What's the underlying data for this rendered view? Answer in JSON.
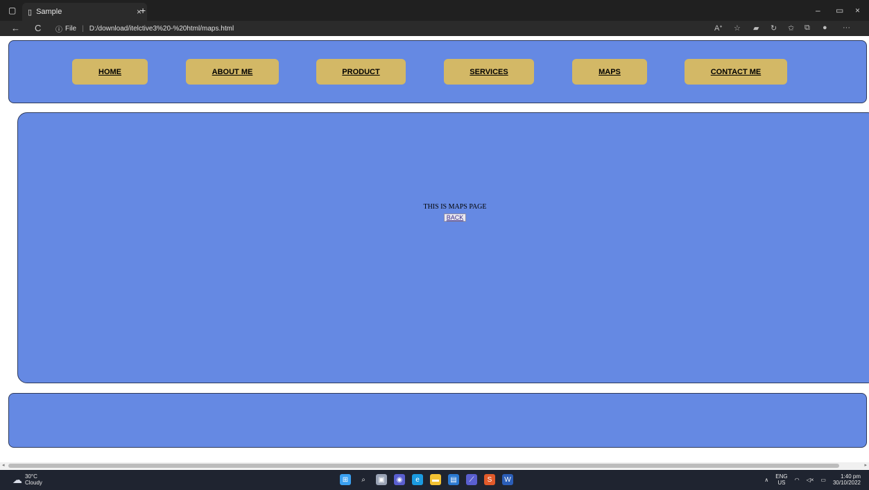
{
  "browser": {
    "tab_title": "Sample",
    "tab_close": "×",
    "new_tab": "+",
    "url_prefix": "File",
    "url": "D:/download/itelctive3%20-%20html/maps.html",
    "back_glyph": "←",
    "reload_glyph": "C",
    "window_min": "–",
    "window_max": "▭",
    "window_close": "×",
    "more_glyph": "···"
  },
  "nav": {
    "items": [
      {
        "label": "HOME"
      },
      {
        "label": "ABOUT ME"
      },
      {
        "label": "PRODUCT"
      },
      {
        "label": "SERVICES"
      },
      {
        "label": "MAPS"
      },
      {
        "label": "CONTACT ME"
      }
    ]
  },
  "main": {
    "text": "THIS IS MAPS PAGE",
    "back_label": "BACK"
  },
  "taskbar": {
    "weather_temp": "30°C",
    "weather_desc": "Cloudy",
    "lang": "ENG",
    "region": "US",
    "time": "1:40 pm",
    "date": "30/10/2022"
  },
  "colors": {
    "panel": "#6589e3",
    "nav_button": "#d3b866"
  }
}
